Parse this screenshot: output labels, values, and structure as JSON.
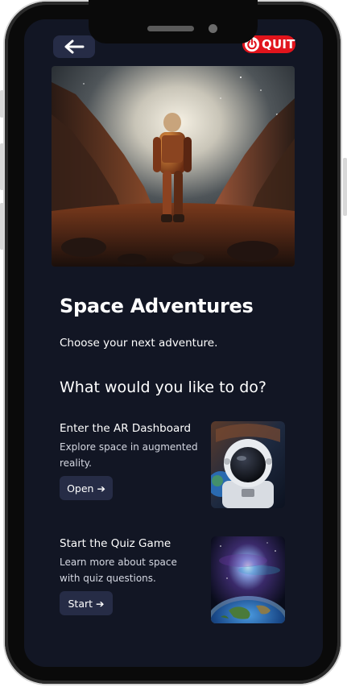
{
  "header": {
    "back_icon": "arrow-left-icon",
    "quit_icon": "power-icon",
    "quit_label": "QUIT",
    "quit_color": "#e1141c"
  },
  "hero": {
    "image": "astronaut-standing-in-rocky-canyon"
  },
  "page": {
    "title": "Space Adventures",
    "subtitle": "Choose your next adventure.",
    "question": "What would you like to do?"
  },
  "options": [
    {
      "title": "Enter the AR Dashboard",
      "description": "Explore space in augmented reality.",
      "button_label": "Open ➔",
      "image": "astronaut-helmet-portrait"
    },
    {
      "title": "Start the Quiz Game",
      "description": "Learn more about space with quiz questions.",
      "button_label": "Start ➔",
      "image": "earth-from-space"
    }
  ],
  "colors": {
    "screen_background": "#121624",
    "button_background": "#262c46",
    "text": "#ffffff"
  }
}
